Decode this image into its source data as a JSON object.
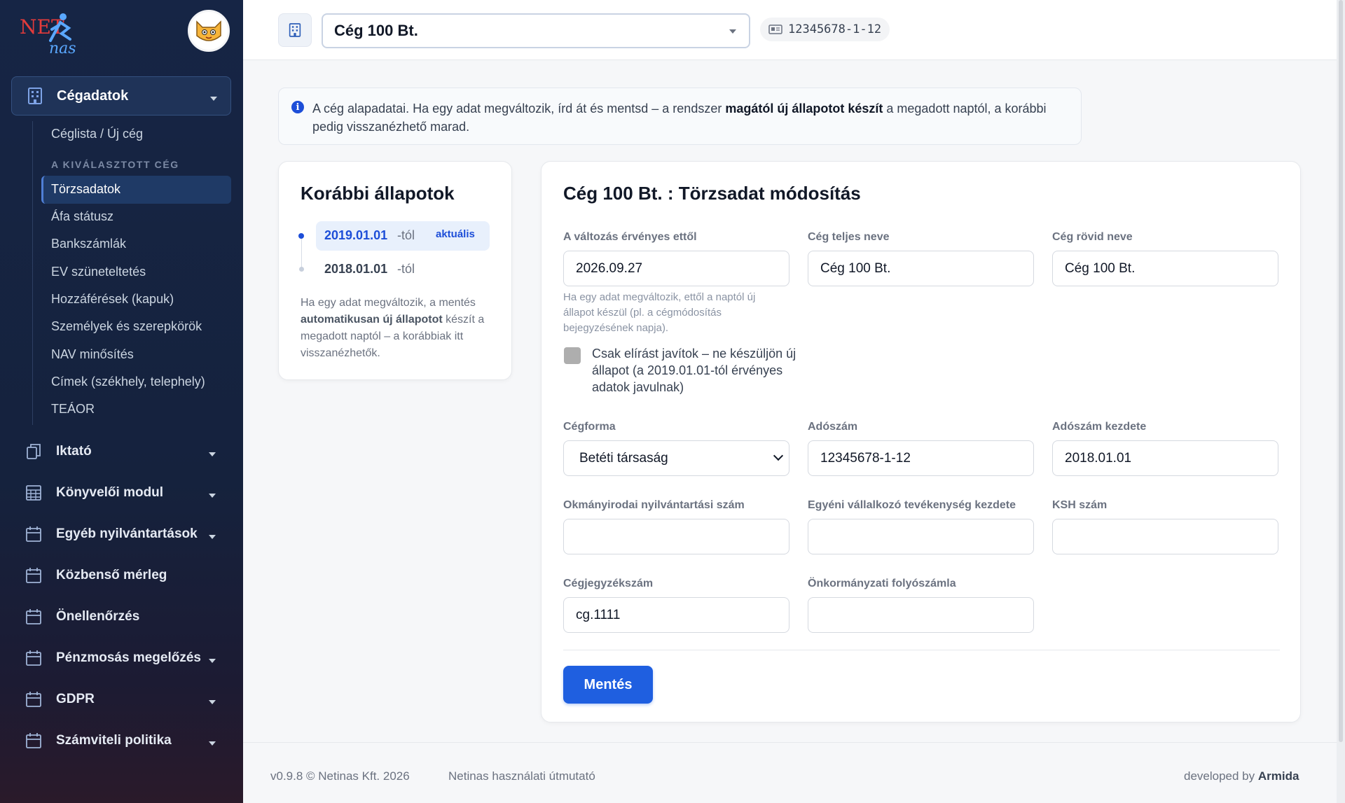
{
  "sidebar": {
    "logo_text": "NETinas",
    "section": {
      "label": "Cégadatok",
      "icon": "building-icon"
    },
    "sub_items": [
      {
        "label": "Céglista / Új cég"
      }
    ],
    "selected_company_title": "A KIVÁLASZTOTT CÉG",
    "company_items": [
      {
        "label": "Törzsadatok",
        "active": true
      },
      {
        "label": "Áfa státusz"
      },
      {
        "label": "Bankszámlák"
      },
      {
        "label": "EV szüneteltetés"
      },
      {
        "label": "Hozzáférések (kapuk)"
      },
      {
        "label": "Személyek és szerepkörök"
      },
      {
        "label": "NAV minősítés"
      },
      {
        "label": "Címek (székhely, telephely)"
      },
      {
        "label": "TEÁOR"
      }
    ],
    "nav": [
      {
        "label": "Iktató",
        "icon": "documents-icon",
        "expandable": true
      },
      {
        "label": "Könyvelői modul",
        "icon": "calculator-icon",
        "expandable": true
      },
      {
        "label": "Egyéb nyilvántartások",
        "icon": "calendar-icon",
        "expandable": true
      },
      {
        "label": "Közbenső mérleg",
        "icon": "calendar-icon",
        "expandable": false
      },
      {
        "label": "Önellenőrzés",
        "icon": "calendar-icon",
        "expandable": false
      },
      {
        "label": "Pénzmosás megelőzés",
        "icon": "calendar-icon",
        "expandable": true
      },
      {
        "label": "GDPR",
        "icon": "calendar-icon",
        "expandable": true
      },
      {
        "label": "Számviteli politika",
        "icon": "calendar-icon",
        "expandable": true
      }
    ]
  },
  "topbar": {
    "company": "Cég 100 Bt.",
    "tax_number": "12345678-1-12"
  },
  "info": {
    "text_before": "A cég alapadatai. Ha egy adat megváltozik, írd át és mentsd – a rendszer ",
    "text_bold": "magától új állapotot készít",
    "text_after": " a megadott naptól, a korábbi pedig visszanézhető marad."
  },
  "history": {
    "title": "Korábbi állapotok",
    "items": [
      {
        "date": "2019.01.01",
        "suffix": "-tól",
        "badge": "aktuális"
      },
      {
        "date": "2018.01.01",
        "suffix": "-tól"
      }
    ],
    "note_before": "Ha egy adat megváltozik, a mentés ",
    "note_bold": "automatikusan új állapotot",
    "note_after": " készít a megadott naptól – a korábbiak itt visszanézhetők."
  },
  "form": {
    "title": "Cég 100 Bt. : Törzsadat módosítás",
    "valid_from": {
      "label": "A változás érvényes ettől",
      "value": "2026.09.27"
    },
    "full_name": {
      "label": "Cég teljes neve",
      "value": "Cég 100 Bt."
    },
    "short_name": {
      "label": "Cég rövid neve",
      "value": "Cég 100 Bt."
    },
    "hint": "Ha egy adat megváltozik, ettől a naptól új állapot készül (pl. a cégmódosítás bejegyzésének napja).",
    "typo_checkbox": "Csak elírást javítok – ne készüljön új állapot (a 2019.01.01-tól érvényes adatok javulnak)",
    "company_form": {
      "label": "Cégforma",
      "value": "Betéti társaság"
    },
    "tax_number": {
      "label": "Adószám",
      "value": "12345678-1-12"
    },
    "tax_start": {
      "label": "Adószám kezdete",
      "value": "2018.01.01"
    },
    "registry_number": {
      "label": "Okmányirodai nyilvántartási szám",
      "value": ""
    },
    "sole_trader_start": {
      "label": "Egyéni vállalkozó tevékenység kezdete",
      "value": ""
    },
    "ksh_number": {
      "label": "KSH szám",
      "value": ""
    },
    "company_reg_number": {
      "label": "Cégjegyzékszám",
      "value": "cg.1111"
    },
    "municipal_account": {
      "label": "Önkormányzati folyószámla",
      "value": ""
    },
    "save_label": "Mentés"
  },
  "footer": {
    "version": "v0.9.8 © Netinas Kft. 2026",
    "guide": "Netinas használati útmutató",
    "dev_prefix": "developed by ",
    "dev_name": "Armida"
  },
  "colors": {
    "sidebar_bg": "#162545",
    "accent": "#1f5fe0",
    "badge_bg": "#e8f0fc"
  }
}
